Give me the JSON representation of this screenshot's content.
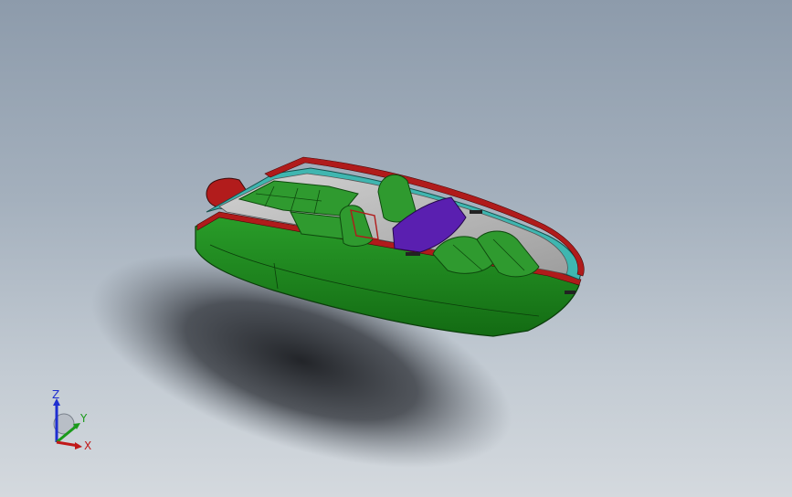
{
  "view": {
    "background_top": "#8d9bab",
    "background_bottom": "#d4d9de",
    "model": {
      "hull_color": "#1f8a1f",
      "deck_trim_color": "#3fb6b0",
      "gunwale_color": "#b01b1b",
      "deck_color": "#b9b9b9",
      "seat_color": "#2f9a2f",
      "windshield_color": "#5a1fb0",
      "motor_color": "#b01b1b"
    }
  },
  "triad": {
    "z_label": "Z",
    "y_label": "Y",
    "x_label": "X",
    "z_color": "#1f2fd0",
    "y_color": "#1a9a1a",
    "x_color": "#c01818"
  }
}
